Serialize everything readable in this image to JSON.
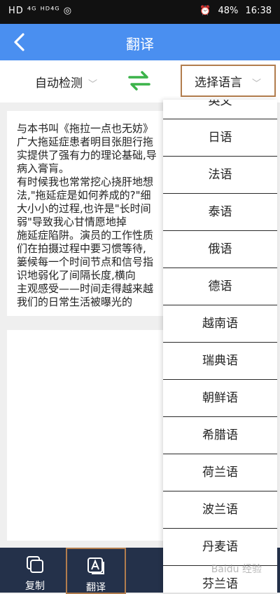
{
  "status_bar": {
    "left": "HD ⁴ᴳ ᴴᴰ⁴ᴳ ◎",
    "signal": "▮",
    "battery": "48%",
    "time": "16:38"
  },
  "header": {
    "title": "翻译"
  },
  "lang_bar": {
    "source": "自动检测",
    "target": "选择语言",
    "chevron": "﹀"
  },
  "source_text": "与本书叫《拖拉一点也无妨》\n广大拖延症患者明目张胆行拖\n实提供了强有力的理论基础,导\n病入膏肓。\n有时候我也常常挖心挠肝地想\n法,\"拖延症是如何养成的?\"细\n大小小的过程,也许是\"长时间\n弱\"导致我心甘情愿地掉\n施延症陷阱。演员的工作性质\n们在拍摄过程中要习惯等待,\n篓候每一个时间节点和信号指\n识地弱化了间隔长度,横向\n主观感受——时间走得越来越\n我们的日常生活被曝光的",
  "languages": [
    "英文",
    "日语",
    "法语",
    "泰语",
    "俄语",
    "德语",
    "越南语",
    "瑞典语",
    "朝鲜语",
    "希腊语",
    "荷兰语",
    "波兰语",
    "丹麦语",
    "芬兰语"
  ],
  "toolbar": {
    "copy": "复制",
    "translate": "翻译"
  },
  "watermark": "Baidu 经验",
  "colors": {
    "header": "#4a8ff0",
    "swap": "#3bb34a",
    "toolbar": "#24314a",
    "highlight": "#b27d4e"
  }
}
